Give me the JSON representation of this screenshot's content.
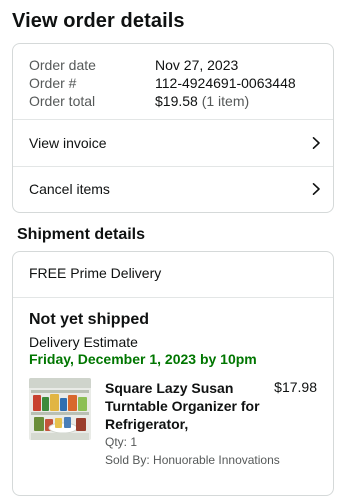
{
  "page": {
    "title": "View order details"
  },
  "order": {
    "summary": [
      {
        "label": "Order date",
        "value": "Nov 27, 2023"
      },
      {
        "label": "Order #",
        "value": "112-4924691-0063448"
      },
      {
        "label": "Order total",
        "value": "$19.58",
        "note": "(1 item)"
      }
    ],
    "actions": {
      "view_invoice": "View invoice",
      "cancel_items": "Cancel items"
    }
  },
  "shipment": {
    "section_title": "Shipment details",
    "delivery_type": "FREE Prime Delivery",
    "status": "Not yet shipped",
    "estimate_label": "Delivery Estimate",
    "estimate_date": "Friday, December 1, 2023 by 10pm",
    "item": {
      "title": "Square Lazy Susan Turntable Organizer for Refrigerator,",
      "price": "$17.98",
      "qty": "Qty: 1",
      "seller": "Sold By: Honuorable Innovations"
    }
  },
  "colors": {
    "estimate_green": "#007600",
    "border": "#d5d9d9",
    "muted": "#565959"
  },
  "icons": {
    "row_arrow": "chevron-right-icon"
  }
}
